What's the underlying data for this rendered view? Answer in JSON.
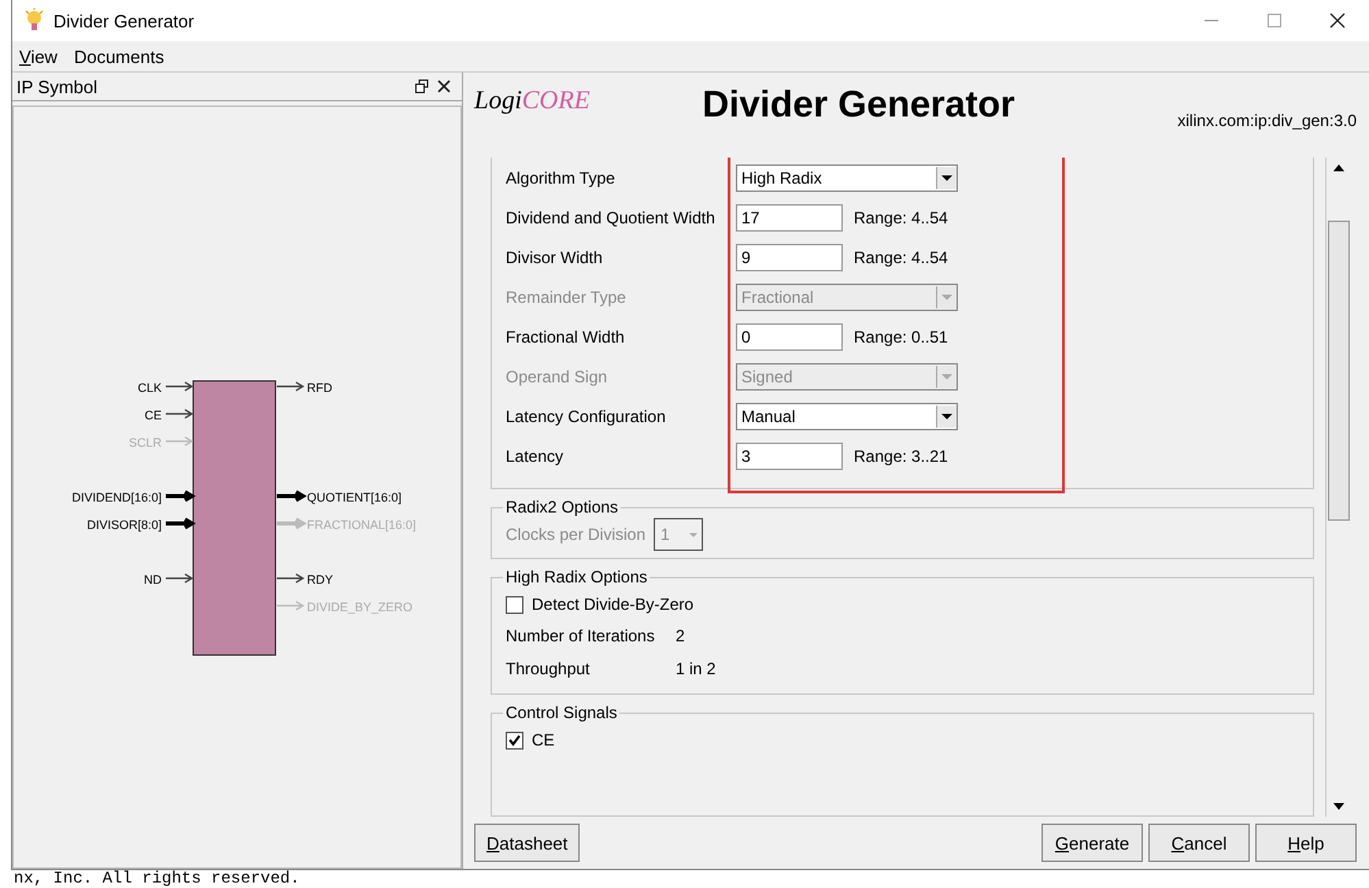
{
  "background_text": "nx, Inc.  All rights reserved.",
  "window": {
    "title": "Divider Generator"
  },
  "menu": [
    {
      "label": "View",
      "underlined": true
    },
    {
      "label": "Documents",
      "underlined": false
    }
  ],
  "symbol_panel": {
    "title": "IP Symbol",
    "inputs": [
      [
        {
          "label": "CLK",
          "bus": false,
          "enabled": true
        },
        {
          "label": "CE",
          "bus": false,
          "enabled": true
        },
        {
          "label": "SCLR",
          "bus": false,
          "enabled": false
        }
      ],
      [
        {
          "label": "DIVIDEND[16:0]",
          "bus": true,
          "enabled": true
        },
        {
          "label": "DIVISOR[8:0]",
          "bus": true,
          "enabled": true
        }
      ],
      [
        {
          "label": "ND",
          "bus": false,
          "enabled": true
        }
      ]
    ],
    "outputs": [
      [
        {
          "label": "RFD",
          "bus": false,
          "enabled": true
        }
      ],
      [
        {
          "label": "QUOTIENT[16:0]",
          "bus": true,
          "enabled": true
        },
        {
          "label": "FRACTIONAL[16:0]",
          "bus": true,
          "enabled": false
        }
      ],
      [
        {
          "label": "RDY",
          "bus": false,
          "enabled": true
        },
        {
          "label": "DIVIDE_BY_ZERO",
          "bus": false,
          "enabled": false
        }
      ]
    ]
  },
  "header": {
    "logo_prefix": "Logi",
    "logo_suffix": "CORE",
    "title": "Divider Generator",
    "ip_name": "xilinx.com:ip:div_gen:3.0"
  },
  "main_settings": {
    "highlighted": true,
    "rows": [
      {
        "kind": "dropdown",
        "label": "Algorithm Type",
        "value": "High Radix",
        "disabled": false
      },
      {
        "kind": "text",
        "label": "Dividend and Quotient Width",
        "value": "17",
        "range": "Range: 4..54",
        "disabled": false
      },
      {
        "kind": "text",
        "label": "Divisor Width",
        "value": "9",
        "range": "Range: 4..54",
        "disabled": false
      },
      {
        "kind": "dropdown",
        "label": "Remainder Type",
        "value": "Fractional",
        "disabled": true
      },
      {
        "kind": "text",
        "label": "Fractional Width",
        "value": "0",
        "range": "Range: 0..51",
        "disabled": false
      },
      {
        "kind": "dropdown",
        "label": "Operand Sign",
        "value": "Signed",
        "disabled": true
      },
      {
        "kind": "dropdown",
        "label": "Latency Configuration",
        "value": "Manual",
        "disabled": false
      },
      {
        "kind": "text",
        "label": "Latency",
        "value": "3",
        "range": "Range: 3..21",
        "disabled": false
      }
    ]
  },
  "radix2_options": {
    "title": "Radix2 Options",
    "label": "Clocks per Division",
    "value": "1",
    "disabled": true
  },
  "high_radix_options": {
    "title": "High Radix Options",
    "detect_label": "Detect Divide-By-Zero",
    "detect_checked": false,
    "info": [
      {
        "label": "Number of Iterations",
        "value": "2"
      },
      {
        "label": "Throughput",
        "value": "1 in 2"
      }
    ]
  },
  "control_signals": {
    "title": "Control Signals",
    "items": [
      {
        "label": "CE",
        "checked": true
      }
    ]
  },
  "buttons": {
    "left": [
      {
        "label": "Datasheet"
      }
    ],
    "right": [
      {
        "label": "Generate"
      },
      {
        "label": "Cancel"
      },
      {
        "label": "Help"
      }
    ]
  }
}
